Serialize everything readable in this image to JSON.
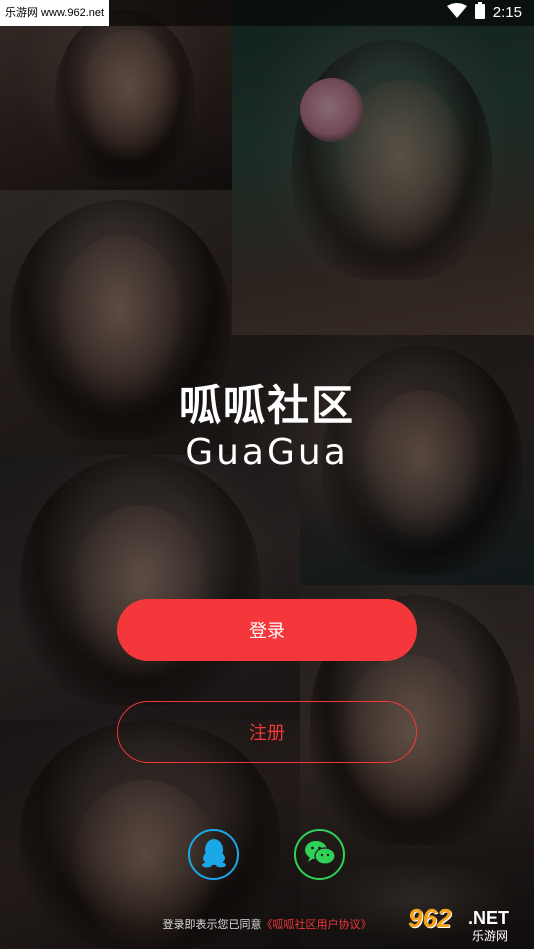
{
  "status_bar": {
    "watermark": "乐游网 www.962.net",
    "time": "2:15",
    "wifi_icon": "wifi-icon",
    "battery_icon": "battery-icon"
  },
  "logo": {
    "chinese": "呱呱社区",
    "english": "GuaGua"
  },
  "actions": {
    "login_label": "登录",
    "register_label": "注册"
  },
  "social": {
    "qq_icon": "qq-icon",
    "wechat_icon": "wechat-icon"
  },
  "agreement": {
    "prefix": "登录即表示您已同意",
    "link": "《呱呱社区用户协议》"
  },
  "corner_watermark": {
    "number": "962",
    "domain": ".NET",
    "site_name": "乐游网"
  },
  "colors": {
    "accent": "#f4373a",
    "qq": "#1aa7e8",
    "wechat": "#2fd158"
  }
}
